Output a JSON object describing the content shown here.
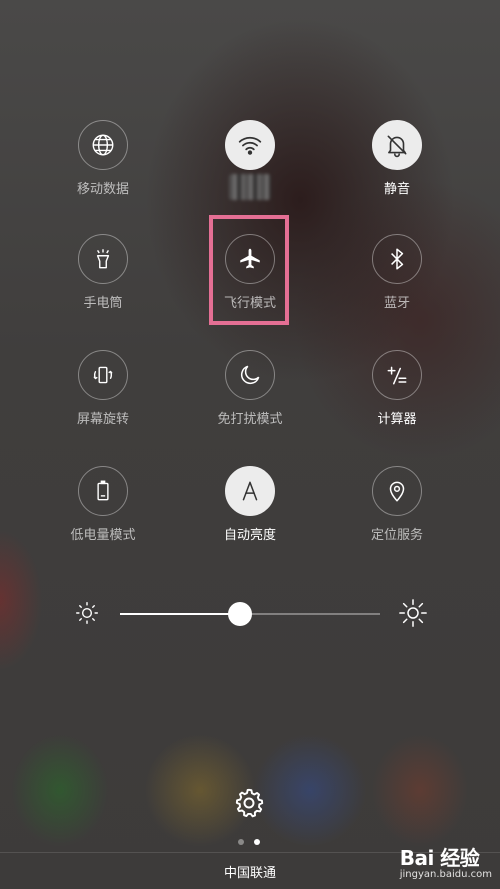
{
  "tiles": [
    {
      "id": "mobile-data",
      "label": "移动数据",
      "icon": "globe-icon",
      "active": false
    },
    {
      "id": "wifi",
      "label": "",
      "icon": "wifi-icon",
      "active": true
    },
    {
      "id": "mute",
      "label": "静音",
      "icon": "bell-mute-icon",
      "active": true
    },
    {
      "id": "flashlight",
      "label": "手电筒",
      "icon": "flashlight-icon",
      "active": false
    },
    {
      "id": "airplane",
      "label": "飞行模式",
      "icon": "airplane-icon",
      "active": false
    },
    {
      "id": "bluetooth",
      "label": "蓝牙",
      "icon": "bluetooth-icon",
      "active": false
    },
    {
      "id": "rotate",
      "label": "屏幕旋转",
      "icon": "rotate-icon",
      "active": false
    },
    {
      "id": "dnd",
      "label": "免打扰模式",
      "icon": "moon-icon",
      "active": false
    },
    {
      "id": "calculator",
      "label": "计算器",
      "icon": "calculator-icon",
      "active": false
    },
    {
      "id": "power-saving",
      "label": "低电量模式",
      "icon": "battery-icon",
      "active": false
    },
    {
      "id": "auto-brightness",
      "label": "自动亮度",
      "icon": "letter-a-icon",
      "active": true
    },
    {
      "id": "location",
      "label": "定位服务",
      "icon": "location-pin-icon",
      "active": false
    }
  ],
  "brightness": {
    "level": 0.46
  },
  "page_indicator": {
    "count": 2,
    "current": 2
  },
  "carrier": "中国联通",
  "watermark": {
    "logo": "Bai 经验",
    "url": "jingyan.baidu.com"
  },
  "colors": {
    "highlight": "#e46f94",
    "active_circle": "#ececec"
  }
}
